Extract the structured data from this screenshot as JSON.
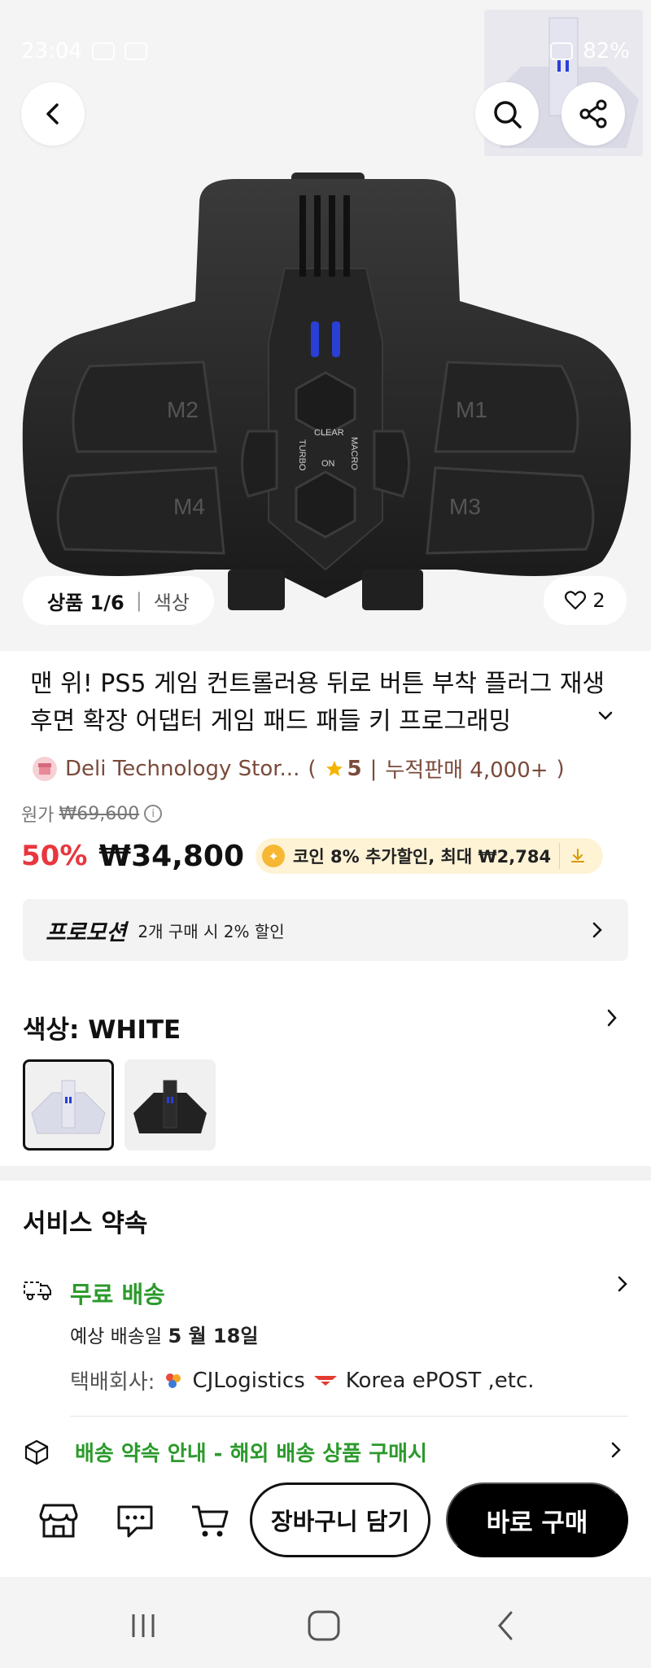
{
  "status_bar": {
    "time": "23:04",
    "battery": "82%"
  },
  "hero": {
    "image_label_counter": "상품 1/6",
    "image_label_option": "색상",
    "like_count": "2",
    "product_labels": [
      "M2",
      "M1",
      "M4",
      "M3",
      "CLEAR",
      "TURBO",
      "ON",
      "MACRO"
    ]
  },
  "product": {
    "title": "맨 위! PS5 게임 컨트롤러용 뒤로 버튼 부착 플러그 재생 후면 확장 어댑터 게임 패드 패들 키 프로그래밍",
    "store_name": "Deli Technology Stor...",
    "rating": "5",
    "sales": "누적판매 4,000+",
    "original_price_label": "원가",
    "original_price": "₩69,600",
    "discount": "50%",
    "price": "₩34,800",
    "coin_offer": "코인 8% 추가할인, 최대 ₩2,784"
  },
  "promotion": {
    "title": "프로모션",
    "text": "2개 구매 시 2% 할인"
  },
  "color_option": {
    "label": "색상: WHITE"
  },
  "service": {
    "title": "서비스 약속",
    "shipping_title": "무료 배송",
    "date_prefix": "예상 배송일",
    "date_value": "5 월 18일",
    "carrier_label": "택배회사:",
    "carrier_1": "CJLogistics",
    "carrier_2": "Korea ePOST ,etc.",
    "promise": "배송 약속 안내 - 해외 배송 상품 구매시"
  },
  "actions": {
    "cart": "장바구니 담기",
    "buy": "바로 구매"
  },
  "colors": {
    "accent_red": "#e8373f",
    "green": "#2c9a2c",
    "brand_brown": "#7a4a3a"
  }
}
